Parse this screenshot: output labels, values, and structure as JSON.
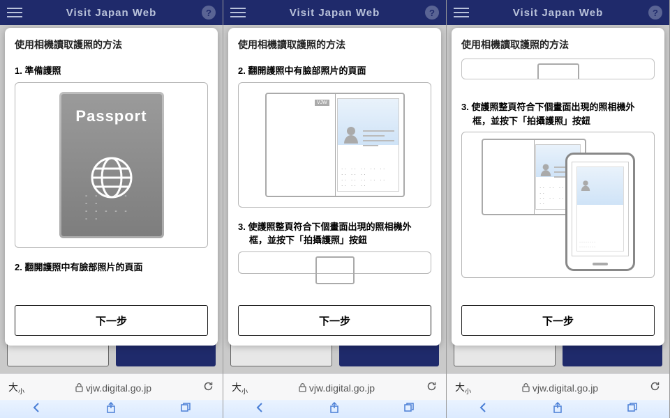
{
  "header": {
    "title": "Visit Japan Web"
  },
  "card_title": "使用相機讀取護照的方法",
  "steps": {
    "s1": "1. 準備護照",
    "s2": "2. 翻開護照中有臉部照片的頁面",
    "s3a": "3. 使護照整頁符合下個畫面出現的照相機外",
    "s3b": "框，並按下「拍攝護照」按鈕"
  },
  "passport_word": "Passport",
  "next_label": "下一步",
  "browser": {
    "aa": "大",
    "aa_small": "小",
    "url": "vjw.digital.go.jp"
  }
}
